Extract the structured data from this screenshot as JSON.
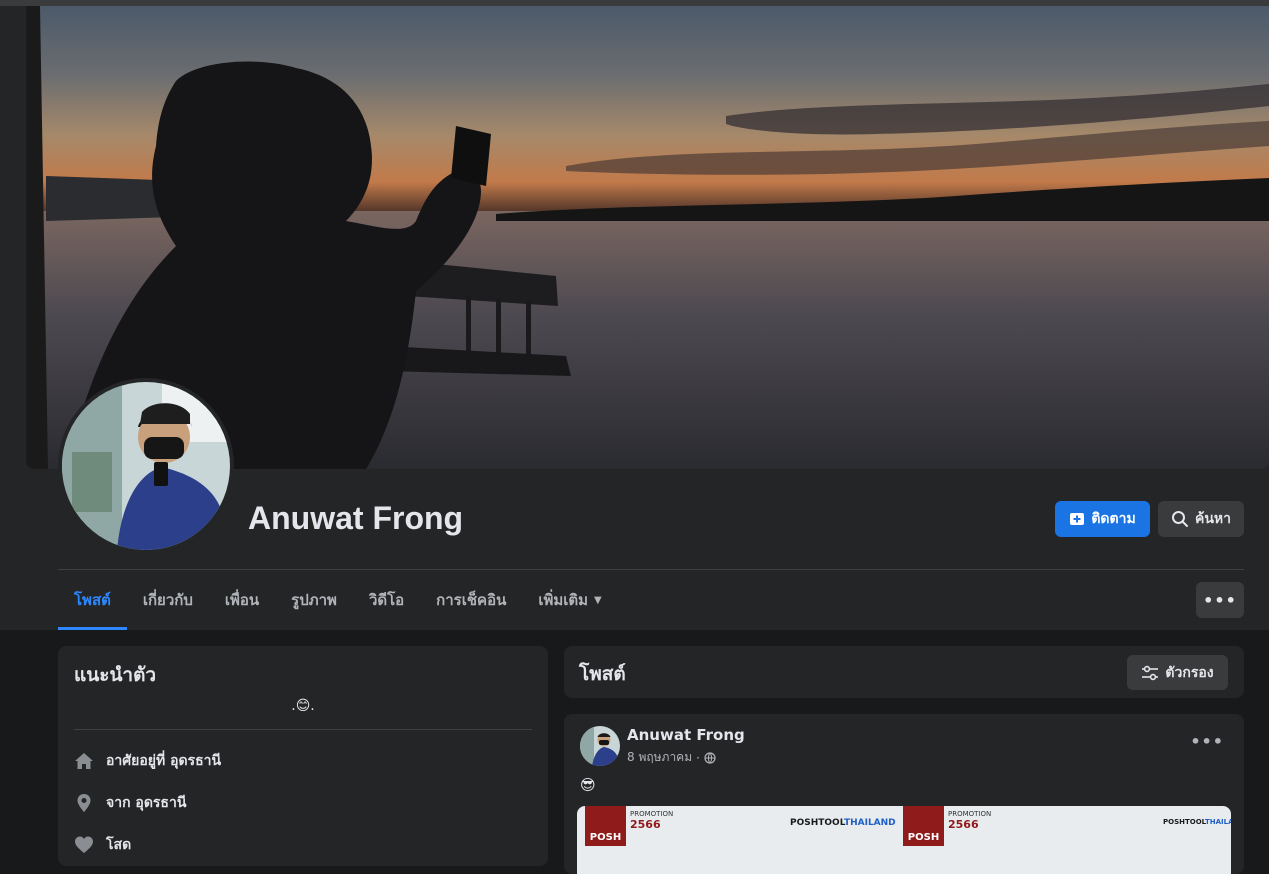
{
  "profile": {
    "name": "Anuwat Frong",
    "follow_label": "ติดตาม",
    "search_label": "ค้นหา"
  },
  "tabs": [
    {
      "label": "โพสต์",
      "active": true
    },
    {
      "label": "เกี่ยวกับ",
      "active": false
    },
    {
      "label": "เพื่อน",
      "active": false
    },
    {
      "label": "รูปภาพ",
      "active": false
    },
    {
      "label": "วิดีโอ",
      "active": false
    },
    {
      "label": "การเช็คอิน",
      "active": false
    },
    {
      "label": "เพิ่มเติม",
      "active": false
    }
  ],
  "tab_more_icon": "ellipsis-icon",
  "intro": {
    "title": "แนะนำตัว",
    "bio": ".😊.",
    "items": [
      {
        "icon": "home-icon",
        "text": "อาศัยอยู่ที่ อุดรธานี"
      },
      {
        "icon": "location-pin-icon",
        "text": "จาก อุดรธานี"
      },
      {
        "icon": "heart-icon",
        "text": "โสด"
      }
    ]
  },
  "posts_section": {
    "title": "โพสต์",
    "filter_label": "ตัวกรอง"
  },
  "post": {
    "author": "Anuwat Frong",
    "date": "8 พฤษภาคม",
    "separator": "·",
    "content": "😎",
    "image": {
      "promo_label": "PROMOTION",
      "promo_year": "2566",
      "logo_text": "POSH",
      "brand_main": "POSHTOOL",
      "brand_accent": "THAILAND"
    }
  },
  "colors": {
    "accent": "#2d88ff",
    "primary_button": "#1b74e4",
    "card_bg": "#242526",
    "page_bg": "#18191a"
  }
}
